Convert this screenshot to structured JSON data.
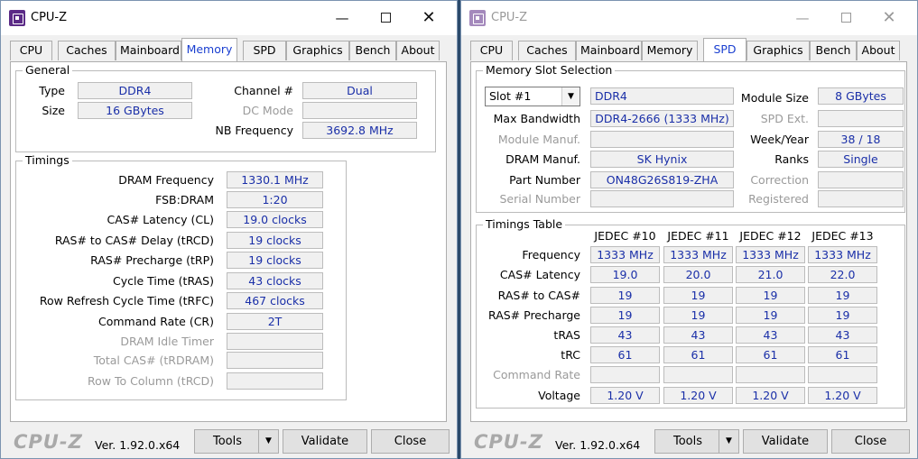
{
  "windows": [
    {
      "title": "CPU-Z",
      "tabs": [
        "CPU",
        "Caches",
        "Mainboard",
        "Memory",
        "SPD",
        "Graphics",
        "Bench",
        "About"
      ],
      "active_tab": "Memory",
      "general": {
        "label": "General",
        "type_label": "Type",
        "type": "DDR4",
        "size_label": "Size",
        "size": "16 GBytes",
        "channel_label": "Channel #",
        "channel": "Dual",
        "dc_mode_label": "DC Mode",
        "dc_mode": "",
        "nb_freq_label": "NB Frequency",
        "nb_freq": "3692.8 MHz"
      },
      "timings": {
        "label": "Timings",
        "rows": [
          {
            "label": "DRAM Frequency",
            "value": "1330.1 MHz",
            "enabled": true
          },
          {
            "label": "FSB:DRAM",
            "value": "1:20",
            "enabled": true
          },
          {
            "label": "CAS# Latency (CL)",
            "value": "19.0 clocks",
            "enabled": true
          },
          {
            "label": "RAS# to CAS# Delay (tRCD)",
            "value": "19 clocks",
            "enabled": true
          },
          {
            "label": "RAS# Precharge (tRP)",
            "value": "19 clocks",
            "enabled": true
          },
          {
            "label": "Cycle Time (tRAS)",
            "value": "43 clocks",
            "enabled": true
          },
          {
            "label": "Row Refresh Cycle Time (tRFC)",
            "value": "467 clocks",
            "enabled": true
          },
          {
            "label": "Command Rate (CR)",
            "value": "2T",
            "enabled": true
          },
          {
            "label": "DRAM Idle Timer",
            "value": "",
            "enabled": false
          },
          {
            "label": "Total CAS# (tRDRAM)",
            "value": "",
            "enabled": false
          },
          {
            "label": "Row To Column (tRCD)",
            "value": "",
            "enabled": false
          }
        ]
      },
      "footer": {
        "brand": "CPU-Z",
        "version": "Ver. 1.92.0.x64",
        "tools": "Tools",
        "validate": "Validate",
        "close": "Close"
      }
    },
    {
      "title": "CPU-Z",
      "tabs": [
        "CPU",
        "Caches",
        "Mainboard",
        "Memory",
        "SPD",
        "Graphics",
        "Bench",
        "About"
      ],
      "active_tab": "SPD",
      "slot": {
        "label": "Memory Slot Selection",
        "selected": "Slot #1",
        "type": "DDR4",
        "module_size_label": "Module Size",
        "module_size": "8 GBytes",
        "max_bw_label": "Max Bandwidth",
        "max_bw": "DDR4-2666 (1333 MHz)",
        "spd_ext_label": "SPD Ext.",
        "spd_ext": "",
        "module_manuf_label": "Module Manuf.",
        "module_manuf": "",
        "week_year_label": "Week/Year",
        "week_year": "38 / 18",
        "dram_manuf_label": "DRAM Manuf.",
        "dram_manuf": "SK Hynix",
        "ranks_label": "Ranks",
        "ranks": "Single",
        "part_label": "Part Number",
        "part": "ON48G26S819-ZHA",
        "correction_label": "Correction",
        "correction": "",
        "serial_label": "Serial Number",
        "serial": "",
        "registered_label": "Registered",
        "registered": ""
      },
      "timings_table": {
        "label": "Timings Table",
        "columns": [
          "JEDEC #10",
          "JEDEC #11",
          "JEDEC #12",
          "JEDEC #13"
        ],
        "rows": [
          {
            "label": "Frequency",
            "values": [
              "1333 MHz",
              "1333 MHz",
              "1333 MHz",
              "1333 MHz"
            ],
            "enabled": true
          },
          {
            "label": "CAS# Latency",
            "values": [
              "19.0",
              "20.0",
              "21.0",
              "22.0"
            ],
            "enabled": true
          },
          {
            "label": "RAS# to CAS#",
            "values": [
              "19",
              "19",
              "19",
              "19"
            ],
            "enabled": true
          },
          {
            "label": "RAS# Precharge",
            "values": [
              "19",
              "19",
              "19",
              "19"
            ],
            "enabled": true
          },
          {
            "label": "tRAS",
            "values": [
              "43",
              "43",
              "43",
              "43"
            ],
            "enabled": true
          },
          {
            "label": "tRC",
            "values": [
              "61",
              "61",
              "61",
              "61"
            ],
            "enabled": true
          },
          {
            "label": "Command Rate",
            "values": [
              "",
              "",
              "",
              ""
            ],
            "enabled": false
          },
          {
            "label": "Voltage",
            "values": [
              "1.20 V",
              "1.20 V",
              "1.20 V",
              "1.20 V"
            ],
            "enabled": true
          }
        ]
      },
      "footer": {
        "brand": "CPU-Z",
        "version": "Ver. 1.92.0.x64",
        "tools": "Tools",
        "validate": "Validate",
        "close": "Close"
      }
    }
  ]
}
